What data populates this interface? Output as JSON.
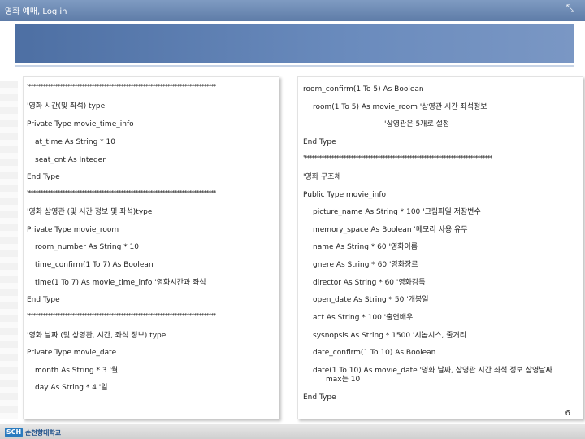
{
  "window": {
    "title": "영화 예매, Log in",
    "corner_icon": "resize-arrows-icon"
  },
  "left_panel": {
    "lines": [
      "'*****************************************************************************",
      "'영화 시간(및 좌석) type",
      "Private Type movie_time_info",
      "at_time As String * 10",
      "seat_cnt As Integer",
      "End Type",
      "'*****************************************************************************",
      "'영화 상영관 (및 시간 정보 및 좌석)type",
      "Private Type movie_room",
      "room_number As String * 10",
      "time_confirm(1 To 7) As Boolean",
      "time(1 To 7) As movie_time_info   '영화시간과 좌석",
      "End Type",
      "'*****************************************************************************",
      "'영화 날짜 (및 상영관, 시간, 좌석 정보) type",
      "Private Type movie_date",
      "month As String * 3   '월",
      "day As String * 4     '일"
    ]
  },
  "right_panel": {
    "lines": [
      "room_confirm(1 To 5) As Boolean",
      "room(1 To 5) As movie_room        '상영관 시간 좌석정보",
      "'상영관은 5개로 설정",
      "End Type",
      "'*****************************************************************************",
      "'영화 구조체",
      "Public Type movie_info",
      "picture_name As String * 100   '그림파일 저장변수",
      "memory_space As Boolean     '메모리 사용 유무",
      "name As String * 60         '영화이름",
      "gnere As String * 60        '영화장르",
      "director As String * 60     '영화감독",
      "open_date As String * 50   '개봉일",
      "act As String * 100         '출연배우",
      "sysnopsis As String * 1500  '시놉시스, 줄거리",
      "date_confirm(1 To 10) As Boolean",
      "date(1 To 10) As movie_date  '영화 날짜, 상영관 시간 좌석 정보 상영날짜",
      "max는 10",
      "End Type"
    ]
  },
  "footer": {
    "logo_mark": "SCH",
    "logo_text": "순천향대학교",
    "page_number": "6"
  }
}
